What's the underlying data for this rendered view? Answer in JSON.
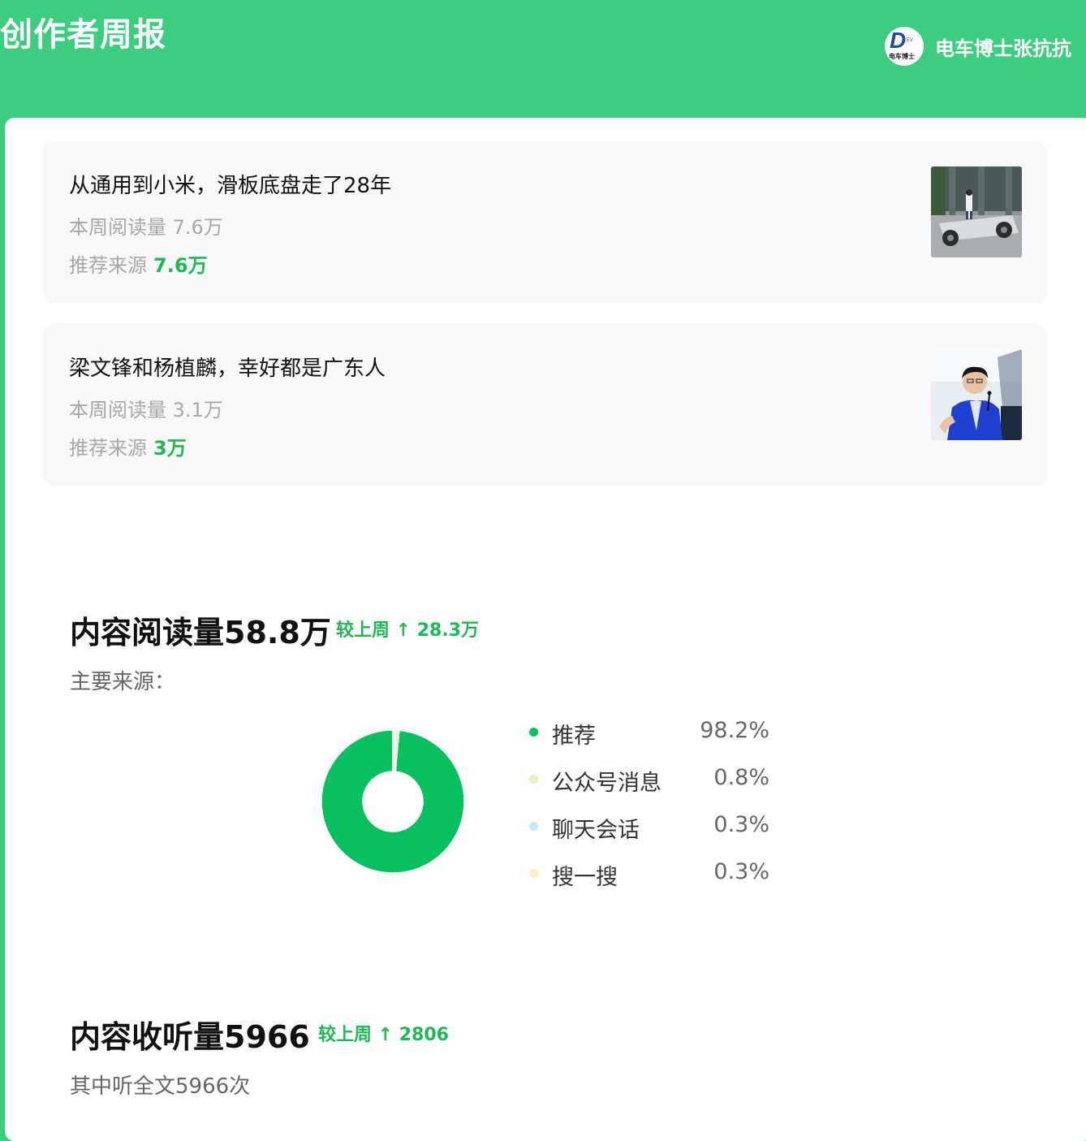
{
  "header": {
    "title": "创作者周报",
    "author_name": "电车博士张抗抗",
    "avatar_text": "电车博士"
  },
  "articles": [
    {
      "title": "从通用到小米，滑板底盘走了28年",
      "weekly_views": "本周阅读量 7.6万",
      "source_label": "推荐来源",
      "source_value": "7.6万"
    },
    {
      "title": "梁文锋和杨植麟，幸好都是广东人",
      "weekly_views": "本周阅读量 3.1万",
      "source_label": "推荐来源",
      "source_value": "3万"
    }
  ],
  "reading": {
    "title": "内容阅读量58.8万",
    "delta": "较上周 ↑ 28.3万",
    "sources_label": "主要来源："
  },
  "chart_data": {
    "type": "pie",
    "categories": [
      "推荐",
      "公众号消息",
      "聊天会话",
      "搜一搜"
    ],
    "values": [
      98.2,
      0.8,
      0.3,
      0.3
    ],
    "value_labels": [
      "98.2%",
      "0.8%",
      "0.3%",
      "0.3%"
    ],
    "colors": [
      "#07c160",
      "#dff5c4",
      "#c9e9fb",
      "#fcefc6"
    ],
    "legend_placement": "right"
  },
  "listening": {
    "title": "内容收听量5966",
    "delta": "较上周 ↑ 2806",
    "full_listen_text": "其中听全文5966次"
  }
}
